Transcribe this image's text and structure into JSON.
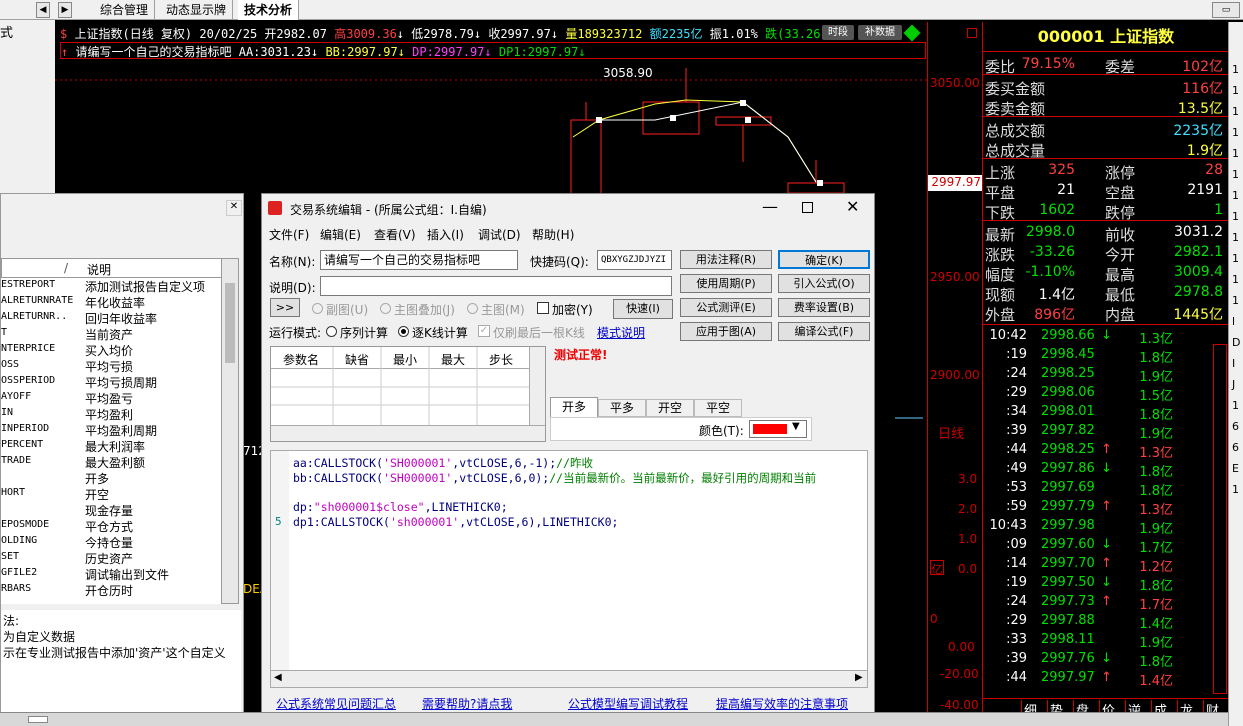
{
  "tabs": [
    "综合管理",
    "动态显示牌",
    "技术分析"
  ],
  "chart": {
    "header_prefix": "$",
    "title": "上证指数(日线 复权) 20/02/25",
    "open": "开2982.07",
    "high": "高3009.36",
    "low": "低2978.79",
    "close": "收2997.97",
    "volume": "量189323712",
    "amount": "额2235亿",
    "amplitude": "振1.01%",
    "change": "跌(33.26",
    "btn_period": "时段",
    "btn_supplement": "补数据",
    "formula_line": "请编写一个自己的交易指标吧",
    "aa": "AA:3031.23",
    "bb": "BB:2997.97",
    "dp": "DP:2997.97",
    "dp1": "DP1:2997.97",
    "peak_label": "3058.90",
    "side_label_712": "712",
    "side_label_dea": "DEA"
  },
  "axis": {
    "p3050": "3050.00",
    "p2997": "2997.97",
    "p2950": "2950.00",
    "p2900": "2900.00",
    "period": "日线",
    "v3": "3.0",
    "v2": "2.0",
    "v1": "1.0",
    "v0": "0.0",
    "unit": "亿",
    "m0": "0.00",
    "m20": "-20.00",
    "m40": "-40.00",
    "arrow_label": "0"
  },
  "quote": {
    "code": "000001",
    "name": "上证指数",
    "rows": [
      {
        "l1": "委比",
        "v1": "79.15%",
        "c1": "red",
        "l2": "委差",
        "v2": "102亿",
        "c2": "red"
      },
      {
        "l1": "委买金额",
        "v1": "",
        "c1": "red",
        "l2": "",
        "v2": "116亿",
        "c2": "red"
      },
      {
        "l1": "委卖金额",
        "v1": "",
        "c1": "green",
        "l2": "",
        "v2": "13.5亿",
        "c2": "yel"
      },
      {
        "l1": "总成交额",
        "v1": "",
        "c1": "cyan",
        "l2": "",
        "v2": "2235亿",
        "c2": "cyan"
      },
      {
        "l1": "总成交量",
        "v1": "",
        "c1": "yel",
        "l2": "",
        "v2": "1.9亿",
        "c2": "yel"
      },
      {
        "l1": "上涨",
        "v1": "325",
        "c1": "red",
        "l2": "涨停",
        "v2": "28",
        "c2": "red"
      },
      {
        "l1": "平盘",
        "v1": "21",
        "c1": "wht",
        "l2": "空盘",
        "v2": "2191",
        "c2": "wht"
      },
      {
        "l1": "下跌",
        "v1": "1602",
        "c1": "green",
        "l2": "跌停",
        "v2": "1",
        "c2": "green"
      },
      {
        "l1": "最新",
        "v1": "2998.0",
        "c1": "green",
        "l2": "前收",
        "v2": "3031.2",
        "c2": "wht"
      },
      {
        "l1": "涨跌",
        "v1": "-33.26",
        "c1": "green",
        "l2": "今开",
        "v2": "2982.1",
        "c2": "green"
      },
      {
        "l1": "幅度",
        "v1": "-1.10%",
        "c1": "green",
        "l2": "最高",
        "v2": "3009.4",
        "c2": "green"
      },
      {
        "l1": "现额",
        "v1": "1.4亿",
        "c1": "wht",
        "l2": "最低",
        "v2": "2978.8",
        "c2": "green"
      },
      {
        "l1": "外盘",
        "v1": "896亿",
        "c1": "red",
        "l2": "内盘",
        "v2": "1445亿",
        "c2": "yel"
      }
    ],
    "ticks": [
      {
        "t": "10:42",
        "p": "2998.66",
        "a": "↓",
        "ac": "green",
        "v": "1.3亿"
      },
      {
        "t": ":19",
        "p": "2998.45",
        "a": "",
        "ac": "",
        "v": "1.8亿"
      },
      {
        "t": ":24",
        "p": "2998.25",
        "a": "",
        "ac": "",
        "v": "1.9亿"
      },
      {
        "t": ":29",
        "p": "2998.06",
        "a": "",
        "ac": "",
        "v": "1.5亿"
      },
      {
        "t": ":34",
        "p": "2998.01",
        "a": "",
        "ac": "",
        "v": "1.8亿"
      },
      {
        "t": ":39",
        "p": "2997.82",
        "a": "",
        "ac": "",
        "v": "1.9亿"
      },
      {
        "t": ":44",
        "p": "2998.25",
        "a": "↑",
        "ac": "red",
        "v": "1.3亿"
      },
      {
        "t": ":49",
        "p": "2997.86",
        "a": "↓",
        "ac": "green",
        "v": "1.8亿"
      },
      {
        "t": ":53",
        "p": "2997.69",
        "a": "",
        "ac": "",
        "v": "1.8亿"
      },
      {
        "t": ":59",
        "p": "2997.79",
        "a": "↑",
        "ac": "red",
        "v": "1.3亿"
      },
      {
        "t": "10:43",
        "p": "2997.98",
        "a": "",
        "ac": "",
        "v": "1.9亿"
      },
      {
        "t": ":09",
        "p": "2997.60",
        "a": "↓",
        "ac": "green",
        "v": "1.7亿"
      },
      {
        "t": ":14",
        "p": "2997.70",
        "a": "↑",
        "ac": "red",
        "v": "1.2亿"
      },
      {
        "t": ":19",
        "p": "2997.50",
        "a": "↓",
        "ac": "green",
        "v": "1.8亿"
      },
      {
        "t": ":24",
        "p": "2997.73",
        "a": "↑",
        "ac": "red",
        "v": "1.7亿"
      },
      {
        "t": ":29",
        "p": "2997.88",
        "a": "",
        "ac": "",
        "v": "1.4亿"
      },
      {
        "t": ":33",
        "p": "2998.11",
        "a": "",
        "ac": "",
        "v": "1.9亿"
      },
      {
        "t": ":39",
        "p": "2997.76",
        "a": "↓",
        "ac": "green",
        "v": "1.8亿"
      },
      {
        "t": ":44",
        "p": "2997.97",
        "a": "↑",
        "ac": "red",
        "v": "1.4亿"
      }
    ],
    "bottom_tabs": [
      "细",
      "势",
      "盘",
      "价",
      "逆",
      "成",
      "龙",
      "财"
    ]
  },
  "right_edge_chars": [
    "",
    "1",
    "1",
    "1",
    "1",
    "1",
    "1",
    "1",
    "1",
    "1",
    "1",
    "1",
    "1",
    "l",
    "D",
    "I",
    "J",
    "1",
    "6",
    "6",
    "E",
    "1"
  ],
  "left_window": {
    "col1": "",
    "col2": "说明",
    "rows": [
      [
        "ESTREPORT",
        "添加测试报告自定义项"
      ],
      [
        "ALRETURNRATE",
        "年化收益率"
      ],
      [
        "ALRETURNR..",
        "回归年收益率"
      ],
      [
        "T",
        "当前资产"
      ],
      [
        "NTERPRICE",
        "买入均价"
      ],
      [
        "OSS",
        "平均亏损"
      ],
      [
        "OSSPERIOD",
        "平均亏损周期"
      ],
      [
        "AYOFF",
        "平均盈亏"
      ],
      [
        "IN",
        "平均盈利"
      ],
      [
        "INPERIOD",
        "平均盈利周期"
      ],
      [
        "PERCENT",
        "最大利润率"
      ],
      [
        "TRADE",
        "最大盈利额"
      ],
      [
        "",
        "开多"
      ],
      [
        "HORT",
        "开空"
      ],
      [
        "",
        "现金存量"
      ],
      [
        "EPOSMODE",
        "平仓方式"
      ],
      [
        "OLDING",
        "今持仓量"
      ],
      [
        "SET",
        "历史资产"
      ],
      [
        "GFILE2",
        "调试输出到文件"
      ],
      [
        "RBARS",
        "开仓历时"
      ]
    ],
    "desc1": "法:",
    "desc2": "为自定义数据",
    "desc3": "示在专业测试报告中添加'资产'这个自定义",
    "left_strip": "式"
  },
  "dialog": {
    "title": "交易系统编辑 - (所属公式组：I.自编)",
    "menu": [
      "文件(F)",
      "编辑(E)",
      "查看(V)",
      "插入(I)",
      "调试(D)",
      "帮助(H)"
    ],
    "name_label": "名称(N):",
    "name_value": "请编写一个自己的交易指标吧",
    "code_label": "快捷码(Q):",
    "code_value": "QBXYGZJDJYZI",
    "desc_label": "说明(D):",
    "desc_value": "",
    "expand": ">>",
    "radio_sub": "副图(U)",
    "radio_main_overlay": "主图叠加(J)",
    "radio_main": "主图(M)",
    "chk_encrypt": "加密(Y)",
    "btn_quick": "快速(I)",
    "run_mode": "运行模式:",
    "radio_seq": "序列计算",
    "radio_bar": "逐K线计算",
    "chk_last": "仅刷最后一根K线",
    "mode_link": "模式说明",
    "buttons": [
      "用法注释(R)",
      "确定(K)",
      "使用周期(P)",
      "引入公式(O)",
      "公式测评(E)",
      "费率设置(B)",
      "应用于图(A)",
      "编译公式(F)"
    ],
    "param_headers": [
      "参数名",
      "缺省",
      "最小",
      "最大",
      "步长"
    ],
    "status": "测试正常!",
    "signal_tabs": [
      "开多",
      "平多",
      "开空",
      "平空"
    ],
    "color_label": "颜色(T):",
    "color_value": "#ff0000",
    "code_lines": [
      {
        "n": "",
        "parts": [
          [
            "aa:",
            "#000080"
          ],
          [
            "CALLSTOCK(",
            "#000080"
          ],
          [
            "'SH000001'",
            "#c000c0"
          ],
          [
            ",vtCLOSE,6,-1);",
            "#000080"
          ],
          [
            "//昨收",
            "#008000"
          ]
        ]
      },
      {
        "n": "",
        "parts": [
          [
            "bb:",
            "#000080"
          ],
          [
            "CALLSTOCK(",
            "#000080"
          ],
          [
            "'SH000001'",
            "#c000c0"
          ],
          [
            ",vtCLOSE,6,0);",
            "#000080"
          ],
          [
            "//当前最新价。当前最新价，最好引用的周期和当前",
            "#008000"
          ]
        ]
      },
      {
        "n": "",
        "parts": []
      },
      {
        "n": "",
        "parts": [
          [
            "dp:",
            "#000080"
          ],
          [
            "\"sh000001$close\"",
            "#c000c0"
          ],
          [
            ",LINETHICK0;",
            "#000080"
          ]
        ]
      },
      {
        "n": "5",
        "parts": [
          [
            "dp1:",
            "#000080"
          ],
          [
            "CALLSTOCK(",
            "#000080"
          ],
          [
            "'sh000001'",
            "#c000c0"
          ],
          [
            ",vtCLOSE,6),LINETHICK0;",
            "#000080"
          ]
        ]
      }
    ],
    "links": [
      "公式系统常见问题汇总",
      "需要帮助?请点我",
      "公式模型编写调试教程",
      "提高编写效率的注意事项"
    ]
  }
}
